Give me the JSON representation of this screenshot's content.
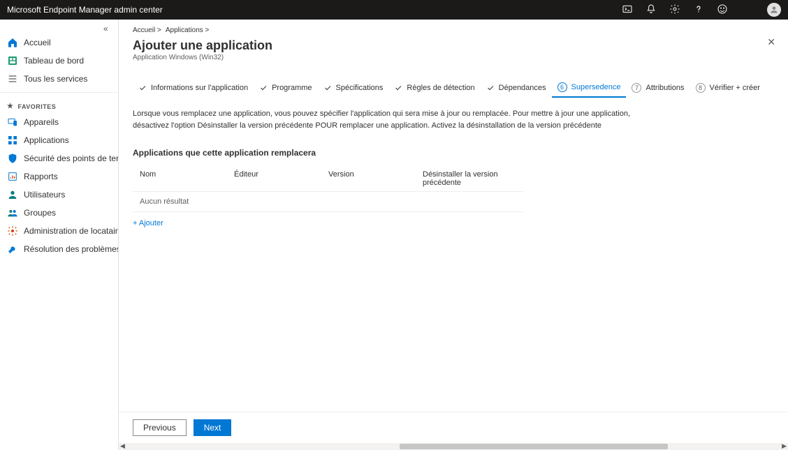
{
  "topbar": {
    "title": "Microsoft Endpoint Manager admin center"
  },
  "sidebar": {
    "home": "Accueil",
    "dashboard": "Tableau de bord",
    "all_services": "Tous les services",
    "favorites_header": "FAVORITES",
    "devices": "Appareils",
    "apps": "Applications",
    "endpoint_security": "Sécurité des points de terminaison",
    "reports": "Rapports",
    "users": "Utilisateurs",
    "groups": "Groupes",
    "tenant_admin": "Administration de locataire",
    "troubleshoot": "Résolution des problèmes + support"
  },
  "breadcrumb": {
    "home": "Accueil >",
    "apps": "Applications >"
  },
  "page": {
    "title": "Ajouter une application",
    "subtitle": "Application Windows (Win32)"
  },
  "wizard": {
    "step1": "Informations sur l'application",
    "step2": "Programme",
    "step3": "Spécifications",
    "step4": "Règles de détection",
    "step5": "Dépendances",
    "step6_num": "6",
    "step6": "Supersedence",
    "step7_num": "7",
    "step7": "Attributions",
    "step8_num": "8",
    "step8": "Vérifier + créer"
  },
  "desc": "Lorsque vous remplacez une application, vous pouvez spécifier l'application qui sera mise à jour ou remplacée. Pour mettre à jour une application, désactivez l'option Désinstaller la version précédente POUR remplacer une application. Activez la désinstallation de la version précédente",
  "section_title": "Applications que cette application remplacera",
  "table": {
    "col_name": "Nom",
    "col_publisher": "Éditeur",
    "col_version": "Version",
    "col_uninstall": "Désinstaller la version précédente",
    "no_result": "Aucun résultat"
  },
  "add_link": "+ Ajouter",
  "buttons": {
    "previous": "Previous",
    "next": "Next"
  }
}
